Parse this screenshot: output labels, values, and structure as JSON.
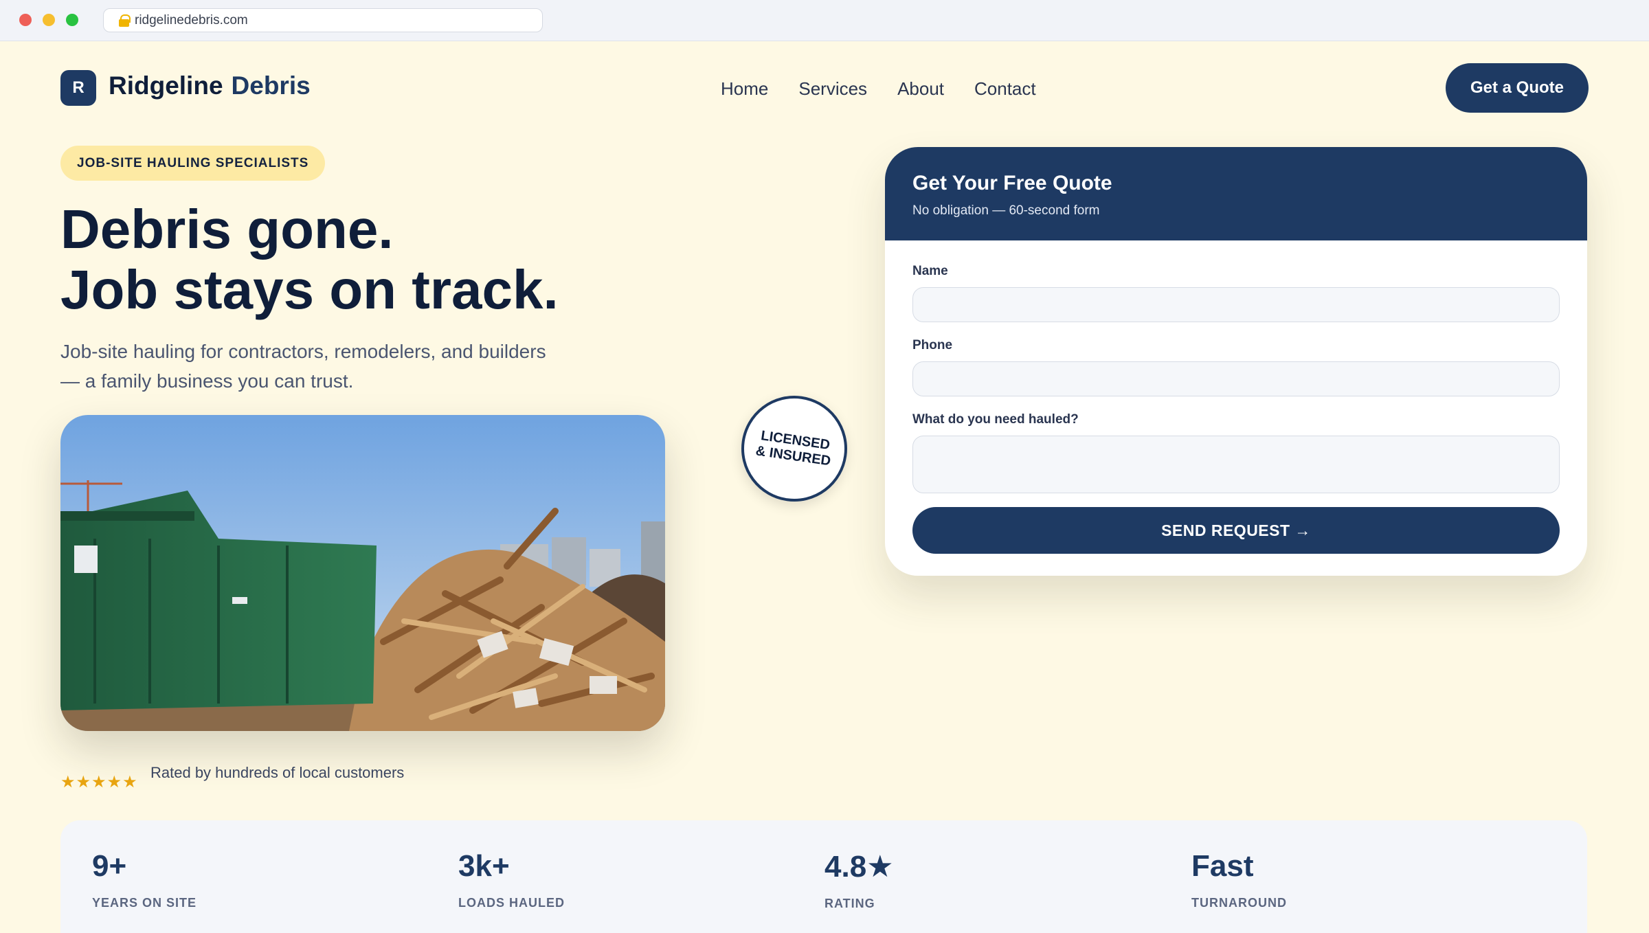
{
  "browser": {
    "url": "ridgelinedebris.com"
  },
  "header": {
    "logo_letter": "R",
    "brand_part1": "Ridgeline",
    "brand_part2": "Debris",
    "nav": [
      "Home",
      "Services",
      "About",
      "Contact"
    ],
    "cta_label": "Get a Quote"
  },
  "hero": {
    "badge": "JOB-SITE HAULING SPECIALISTS",
    "headline_line1": "Debris gone.",
    "headline_line2": "Job stays on track.",
    "subtext": "Job-site hauling for contractors, remodelers, and builders — a family business you can trust.",
    "seal": "LICENSED & INSURED",
    "stars": "★★★★★",
    "rating_text": "Rated by hundreds of local customers"
  },
  "quote_form": {
    "title": "Get Your Free Quote",
    "subtitle": "No obligation — 60-second form",
    "name_label": "Name",
    "name_value": "",
    "phone_label": "Phone",
    "phone_value": "",
    "haul_label": "What do you need hauled?",
    "haul_value": "",
    "submit_label": "SEND REQUEST →"
  },
  "stats": [
    {
      "value": "9+",
      "label": "YEARS ON SITE"
    },
    {
      "value": "3k+",
      "label": "LOADS HAULED"
    },
    {
      "value": "4.8★",
      "label": "RATING"
    },
    {
      "value": "Fast",
      "label": "TURNAROUND"
    }
  ],
  "colors": {
    "navy": "#1e3a63",
    "cream": "#fef9e4",
    "badge": "#fdeaa4",
    "star": "#e8a410"
  }
}
